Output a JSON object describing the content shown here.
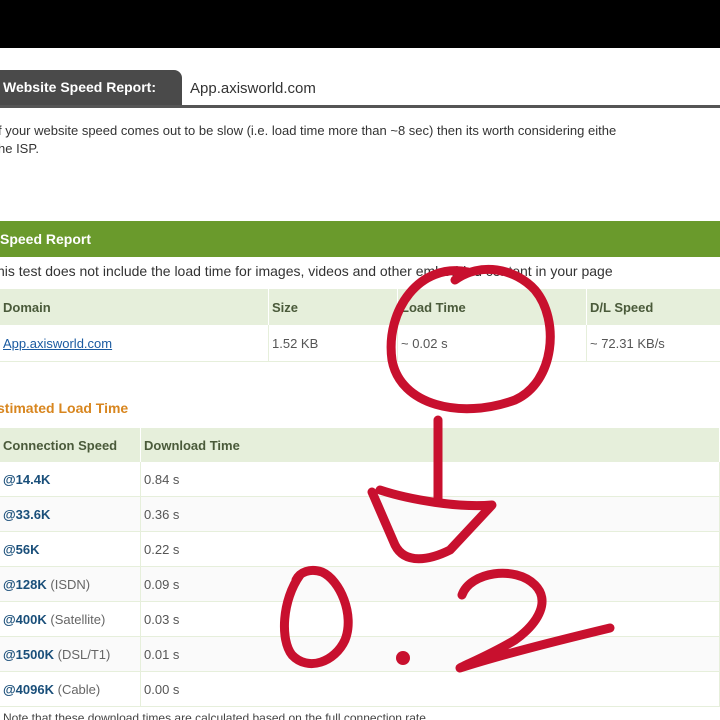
{
  "report": {
    "tab_label": "Website Speed Report:",
    "url": "App.axisworld.com",
    "intro_line1": "f your website speed comes out to be slow (i.e. load time more than ~8 sec) then its worth considering eithe",
    "intro_line2": "he ISP."
  },
  "speed_report": {
    "title": "Speed Report",
    "note": "his test does not include the load time for images, videos and other embedded content in your page",
    "headers": [
      "Domain",
      "Size",
      "Load Time",
      "D/L Speed"
    ],
    "row": {
      "domain": "App.axisworld.com",
      "size": "1.52 KB",
      "load_time": "~ 0.02 s",
      "dl_speed": "~ 72.31 KB/s"
    }
  },
  "estimated": {
    "title": "stimated Load Time",
    "headers": [
      "Connection Speed",
      "Download Time"
    ],
    "rows": [
      {
        "speed": "@14.4K",
        "detail": "",
        "time": "0.84 s"
      },
      {
        "speed": "@33.6K",
        "detail": "",
        "time": "0.36 s"
      },
      {
        "speed": "@56K",
        "detail": "",
        "time": "0.22 s"
      },
      {
        "speed": "@128K",
        "detail": "(ISDN)",
        "time": "0.09 s"
      },
      {
        "speed": "@400K",
        "detail": "(Satellite)",
        "time": "0.03 s"
      },
      {
        "speed": "@1500K",
        "detail": "(DSL/T1)",
        "time": "0.01 s"
      },
      {
        "speed": "@4096K",
        "detail": "(Cable)",
        "time": "0.00 s"
      }
    ]
  },
  "footer_note": "Note that these download times are calculated based on the full connection rate.",
  "annotation": {
    "text": "0.2",
    "color": "#c8102e"
  }
}
